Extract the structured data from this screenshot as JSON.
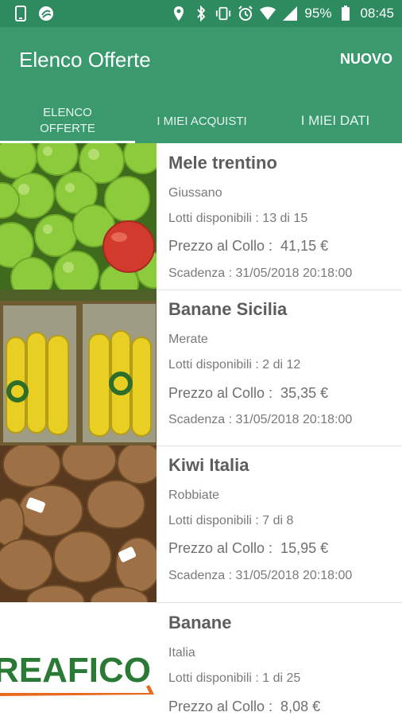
{
  "status": {
    "battery": "95%",
    "time": "08:45"
  },
  "header": {
    "title": "Elenco Offerte",
    "new_label": "NUOVO"
  },
  "tabs": [
    {
      "label": "ELENCO\nOFFERTE",
      "active": true
    },
    {
      "label": "I MIEI ACQUISTI",
      "active": false
    },
    {
      "label": "I MIEI DATI",
      "active": false
    }
  ],
  "offers": [
    {
      "title": "Mele trentino",
      "location": "Giussano",
      "lots": "Lotti disponibili : 13 di 15",
      "price": "Prezzo al Collo :  41,15 €",
      "expiry": "Scadenza : 31/05/2018 20:18:00",
      "image": "green-apples"
    },
    {
      "title": "Banane Sicilia",
      "location": "Merate",
      "lots": "Lotti disponibili : 2 di 12",
      "price": "Prezzo al Collo :  35,35 €",
      "expiry": "Scadenza : 31/05/2018 20:18:00",
      "image": "bananas"
    },
    {
      "title": "Kiwi Italia",
      "location": "Robbiate",
      "lots": "Lotti disponibili : 7 di 8",
      "price": "Prezzo al Collo :  15,95 €",
      "expiry": "Scadenza : 31/05/2018 20:18:00",
      "image": "kiwi"
    },
    {
      "title": "Banane",
      "location": "Italia",
      "lots": "Lotti disponibili : 1 di 25",
      "price": "Prezzo al Collo :  8,08 €",
      "expiry": "",
      "image": "reafico-logo",
      "logo_text": "REAFICO"
    }
  ],
  "colors": {
    "primary": "#3a9a6e",
    "status_bar": "#2e8a5f"
  }
}
